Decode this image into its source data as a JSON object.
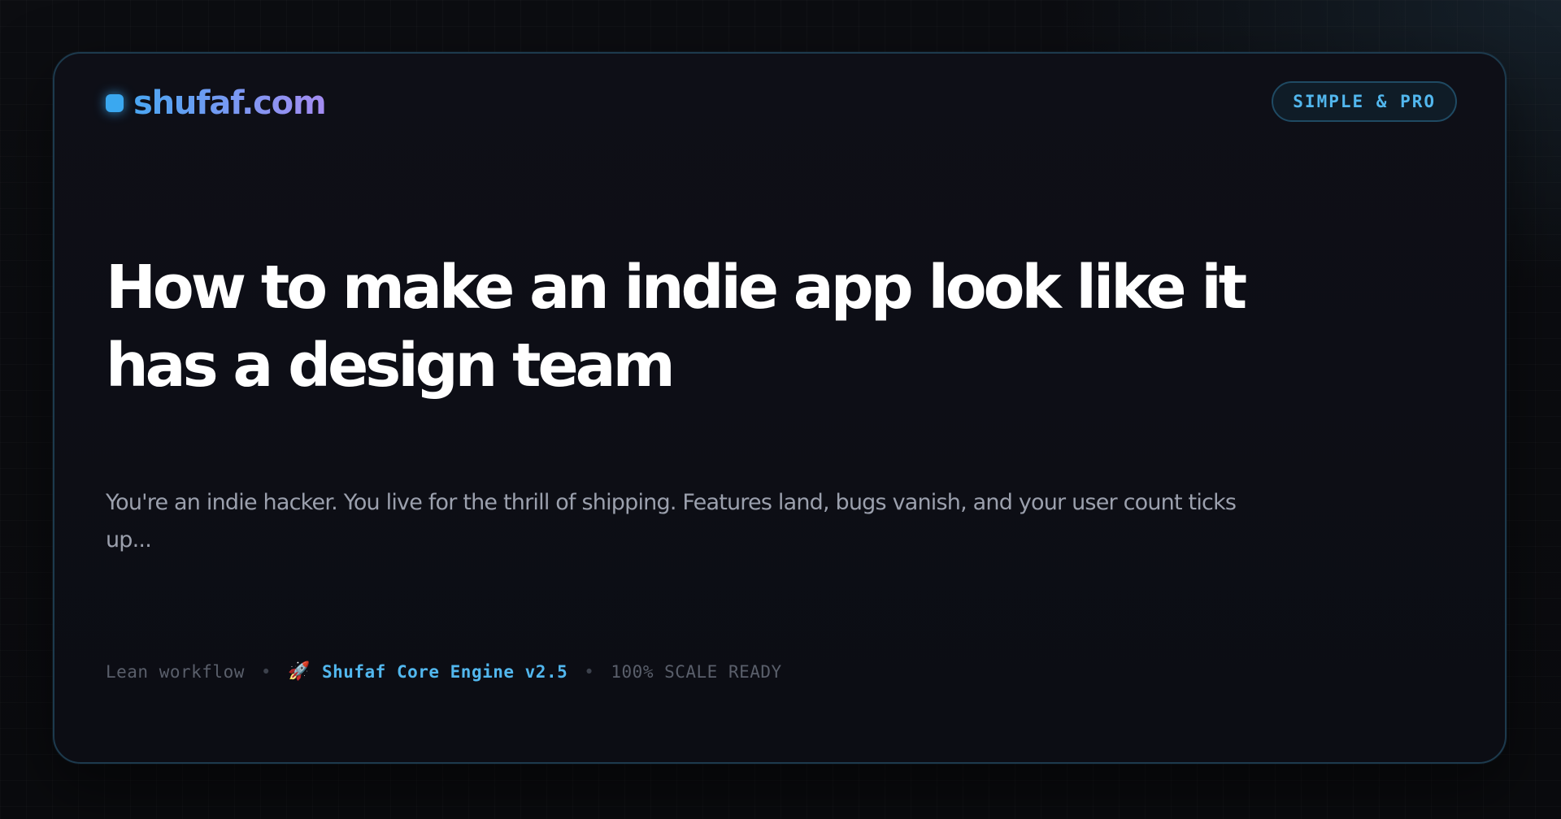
{
  "brand": {
    "name": "shufaf.com",
    "accent": "#3aa8f0",
    "gradient": [
      "#4aa6f2",
      "#a48cf2"
    ]
  },
  "badge": {
    "label": "SIMPLE & PRO"
  },
  "post": {
    "title": "How to make an indie app look like it has a design team",
    "excerpt": "You're an indie hacker. You live for the thrill of shipping. Features land, bugs vanish, and your user count ticks up..."
  },
  "meta": {
    "workflow": "Lean workflow",
    "separator": "•",
    "rocket_icon": "🚀",
    "engine": "Shufaf Core Engine v2.5",
    "scale": "100% SCALE READY"
  },
  "colors": {
    "background": "#0b0c10",
    "card": "#0e0f17",
    "card_border": "#1d3a4d",
    "title": "#ffffff",
    "excerpt": "#9ba0ad",
    "engine": "#52b7ee"
  }
}
